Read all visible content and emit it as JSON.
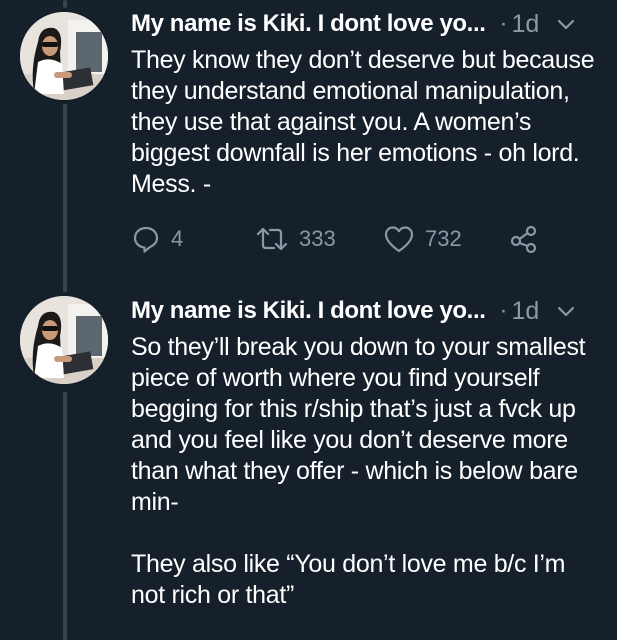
{
  "tweets": [
    {
      "author_name": "My name is Kiki. I dont love yo...",
      "separator": "·",
      "timestamp": "1d",
      "text": "They know they don’t deserve but because they understand emotional manipulation, they use that against you. A women’s biggest downfall is her emotions - oh lord. Mess. -",
      "actions": {
        "reply_count": "4",
        "retweet_count": "333",
        "like_count": "732"
      }
    },
    {
      "author_name": "My name is Kiki. I dont love yo...",
      "separator": "·",
      "timestamp": "1d",
      "text": "So they’ll break you down to your smallest piece of worth where you find yourself begging for this r/ship that’s just a fvck up and you feel like you don’t deserve more than what they offer - which is below bare min-\n\nThey also like “You don’t love me b/c I’m not rich or that”"
    }
  ],
  "icons": {
    "reply": "reply-icon",
    "retweet": "retweet-icon",
    "like": "heart-icon",
    "share": "share-icon",
    "more": "chevron-down-icon"
  },
  "colors": {
    "background": "#15202b",
    "muted_text": "#8899a6",
    "thread_line": "#38444d",
    "text": "#ffffff"
  }
}
